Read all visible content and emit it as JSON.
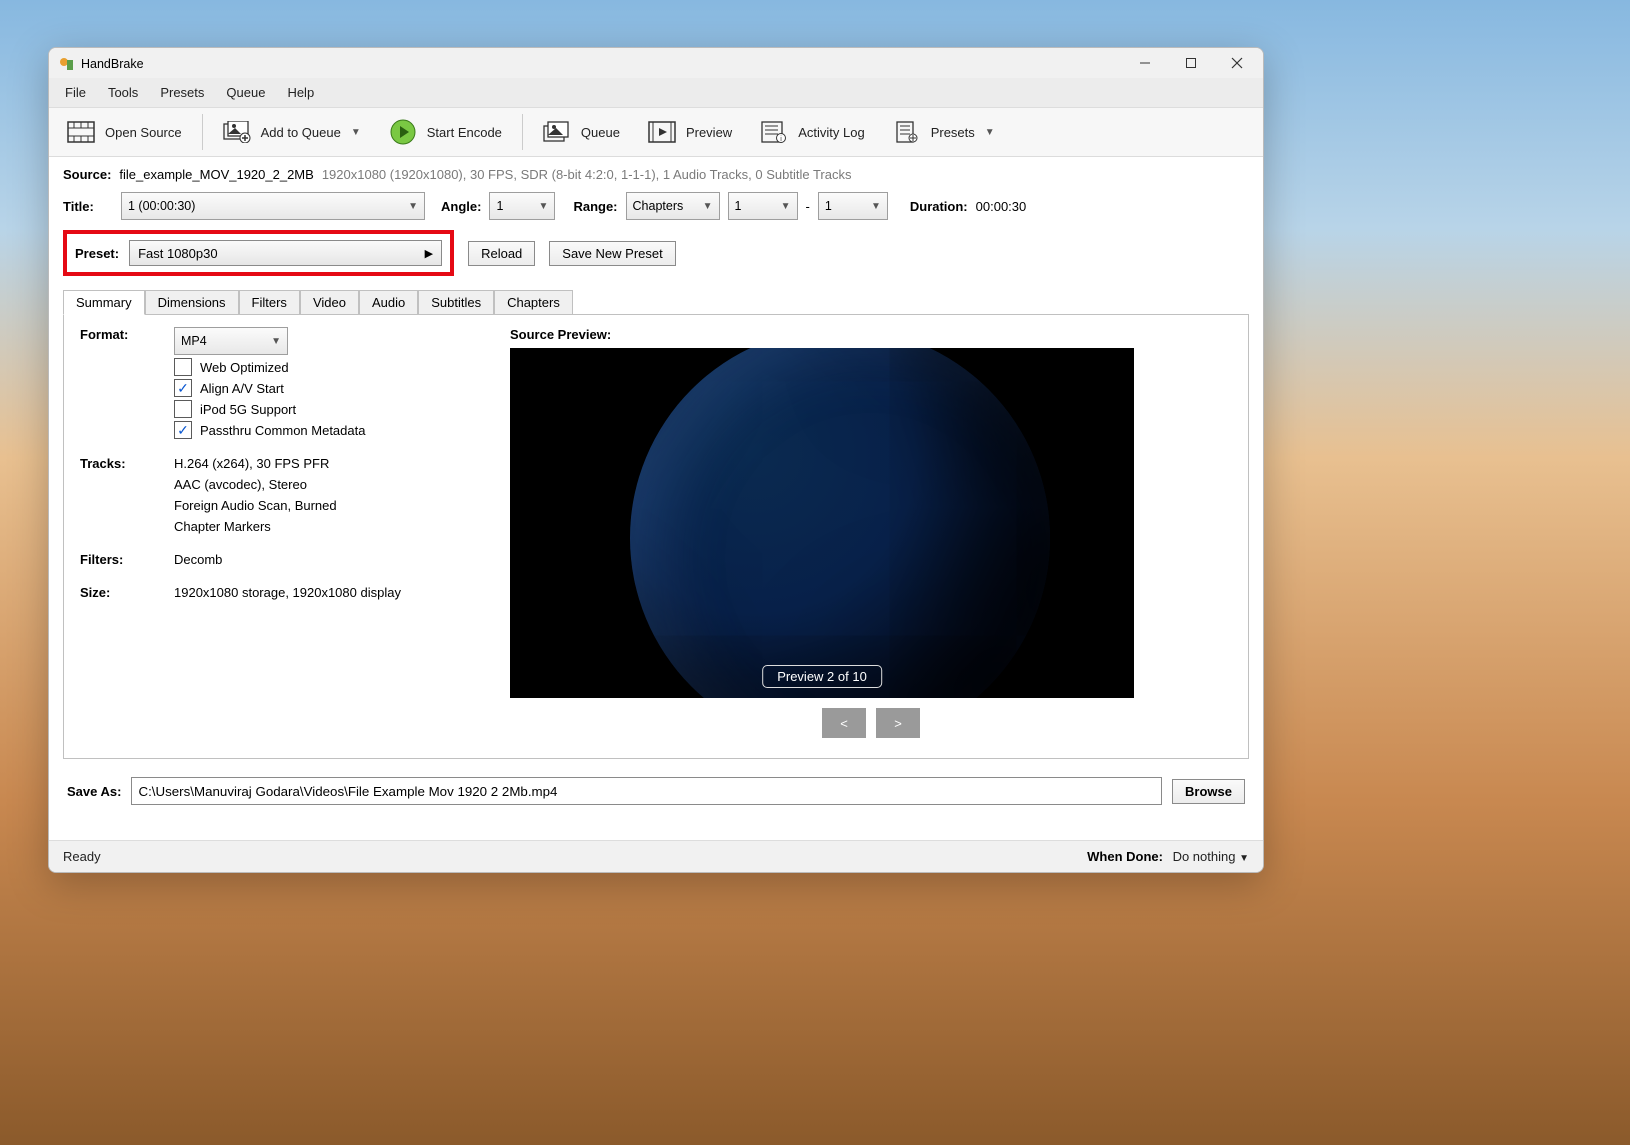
{
  "title": "HandBrake",
  "menu": {
    "file": "File",
    "tools": "Tools",
    "presets": "Presets",
    "queue": "Queue",
    "help": "Help"
  },
  "toolbar": {
    "open": "Open Source",
    "add": "Add to Queue",
    "start": "Start Encode",
    "queue": "Queue",
    "preview": "Preview",
    "activity": "Activity Log",
    "presets": "Presets"
  },
  "source": {
    "label": "Source:",
    "file": "file_example_MOV_1920_2_2MB",
    "details": "1920x1080 (1920x1080), 30 FPS, SDR (8-bit 4:2:0, 1-1-1), 1 Audio Tracks, 0 Subtitle Tracks"
  },
  "title_row": {
    "title_lbl": "Title:",
    "title_val": "1  (00:00:30)",
    "angle_lbl": "Angle:",
    "angle_val": "1",
    "range_lbl": "Range:",
    "range_mode": "Chapters",
    "range_from": "1",
    "range_dash": "-",
    "range_to": "1",
    "duration_lbl": "Duration:",
    "duration_val": "00:00:30"
  },
  "preset": {
    "label": "Preset:",
    "value": "Fast 1080p30",
    "reload": "Reload",
    "save": "Save New Preset"
  },
  "tabs": {
    "summary": "Summary",
    "dimensions": "Dimensions",
    "filters": "Filters",
    "video": "Video",
    "audio": "Audio",
    "subtitles": "Subtitles",
    "chapters": "Chapters"
  },
  "summary": {
    "format_lbl": "Format:",
    "format_val": "MP4",
    "web_opt": "Web Optimized",
    "align": "Align A/V Start",
    "ipod": "iPod 5G Support",
    "passthru": "Passthru Common Metadata",
    "tracks_lbl": "Tracks:",
    "track1": "H.264 (x264), 30 FPS PFR",
    "track2": "AAC (avcodec), Stereo",
    "track3": "Foreign Audio Scan, Burned",
    "track4": "Chapter Markers",
    "filters_lbl": "Filters:",
    "filters_val": "Decomb",
    "size_lbl": "Size:",
    "size_val": "1920x1080 storage, 1920x1080 display",
    "preview_title": "Source Preview:",
    "preview_label": "Preview 2 of 10",
    "prev": "<",
    "next": ">"
  },
  "saveas": {
    "label": "Save As:",
    "path": "C:\\Users\\Manuviraj Godara\\Videos\\File Example Mov 1920 2 2Mb.mp4",
    "browse": "Browse"
  },
  "status": {
    "ready": "Ready",
    "when_done_lbl": "When Done:",
    "when_done_val": "Do nothing"
  }
}
